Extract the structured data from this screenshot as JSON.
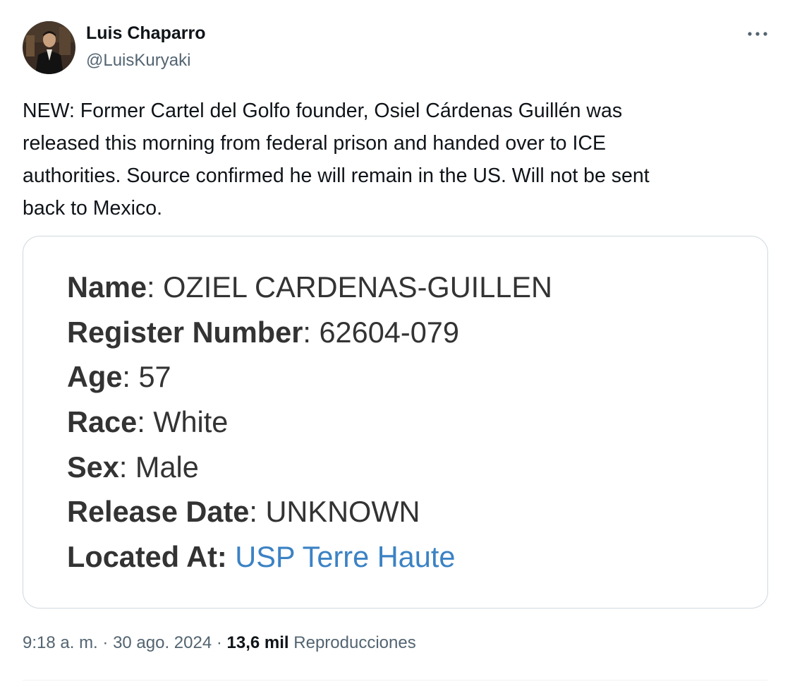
{
  "author": {
    "name": "Luis Chaparro",
    "handle": "@LuisKuryaki"
  },
  "tweet": {
    "lines": [
      "NEW: Former Cartel del Golfo founder, Osiel Cárdenas Guillén was",
      "released this morning from federal prison and handed over to ICE",
      "authorities. Source confirmed he will remain in the US. Will not be sent",
      "back to Mexico."
    ]
  },
  "media": {
    "record": [
      {
        "label": "Name",
        "sep": ": ",
        "value": "OZIEL CARDENAS-GUILLEN"
      },
      {
        "label": "Register Number",
        "sep": ": ",
        "value": "62604-079"
      },
      {
        "label": "Age",
        "sep": ": ",
        "value": "57"
      },
      {
        "label": "Race",
        "sep": ": ",
        "value": "White"
      },
      {
        "label": "Sex",
        "sep": ": ",
        "value": "Male"
      },
      {
        "label": "Release Date",
        "sep": ": ",
        "value": "UNKNOWN"
      },
      {
        "label": "Located At:",
        "sep": " ",
        "value": "USP Terre Haute"
      }
    ],
    "link_color": "#3b82c4"
  },
  "meta": {
    "time": "9:18 a. m.",
    "sep1": " · ",
    "date": "30 ago. 2024",
    "sep2": " · ",
    "views_count": "13,6 mil",
    "views_label": " Reproducciones"
  },
  "icons": {
    "more": "more-horizontal-icon"
  },
  "colors": {
    "primary_text": "#0f1419",
    "secondary_text": "#536471",
    "border": "#cfd9de"
  }
}
